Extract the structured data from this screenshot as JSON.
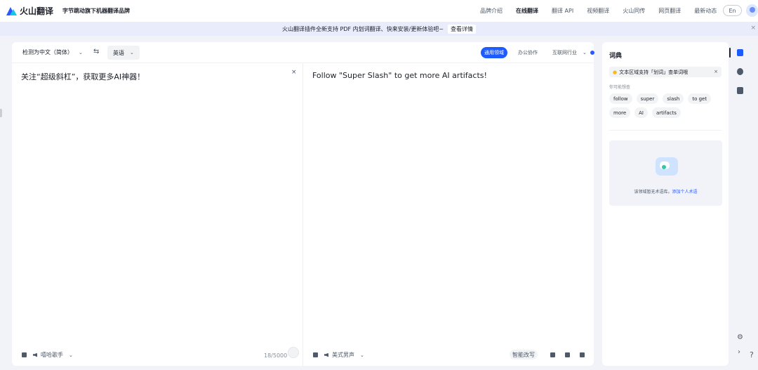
{
  "app": {
    "logo_text": "火山翻译",
    "slogan": "字节跳动旗下机器翻译品牌"
  },
  "nav": {
    "items": [
      "品牌介绍",
      "在线翻译",
      "翻译 API",
      "视频翻译",
      "火山同传",
      "网页翻译",
      "最新动态"
    ],
    "active": "在线翻译",
    "lang_button": "En"
  },
  "banner": {
    "text": "火山翻译插件全新支持 PDF 内划词翻译、快来安装/更新体验吧~",
    "link": "查看详情",
    "close": "×"
  },
  "translator": {
    "source_lang": "检测为中文（简体）",
    "swap_icon": "⇆",
    "target_lang": "英语",
    "domains": {
      "general": "通用领域",
      "office": "办公协作",
      "internet": "互联网行业"
    },
    "source_text": "关注“超级斜杠”，获取更多AI神器！",
    "clear": "×",
    "target_text": "Follow \"Super Slash\" to get more AI artifacts!",
    "source_voice": "嘻哈歌手",
    "char_count": "18/5000",
    "target_voice": "美式男声",
    "smart_rewrite": "智能改写",
    "chevron": "⌄"
  },
  "dictionary": {
    "title": "词典",
    "tip": "文本区域支持「划词」查单词哦",
    "tip_close": "×",
    "subtitle": "你可能想查",
    "chips": [
      "follow",
      "super",
      "slash",
      "to get",
      "more",
      "AI",
      "artifacts"
    ],
    "empty_text": "该领域暂无术语库。",
    "empty_link": "添加个人术语"
  },
  "rail": {
    "gear": "⚙",
    "arrow": "›",
    "help": "?"
  },
  "colors": {
    "brand_blue": "#1e5bff",
    "accent_cyan": "#11c6e8",
    "page_bg": "#f2f3f8"
  }
}
